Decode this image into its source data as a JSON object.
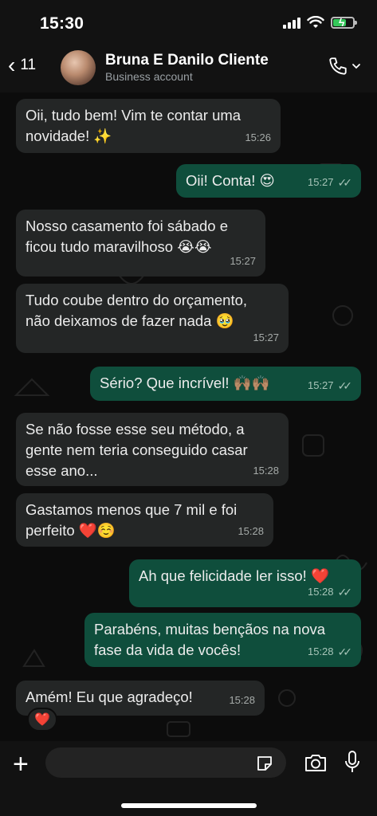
{
  "status_bar": {
    "time": "15:30"
  },
  "header": {
    "back_count": "11",
    "contact_name": "Bruna E Danilo Cliente",
    "contact_subtitle": "Business account"
  },
  "messages": [
    {
      "dir": "in",
      "text": "Oii, tudo bem! Vim te contar uma\nnovidade! ✨",
      "time": "15:26"
    },
    {
      "dir": "out",
      "text": "Oii! Conta! 😍",
      "time": "15:27"
    },
    {
      "dir": "in",
      "text": "Nosso casamento foi sábado e\nficou tudo maravilhoso 😭😭",
      "time": "15:27"
    },
    {
      "dir": "in",
      "text": "Tudo coube dentro do orçamento,\nnão deixamos de fazer nada 🥹",
      "time": "15:27"
    },
    {
      "dir": "out",
      "text": "Sério? Que incrível! 🙌🏽🙌🏽",
      "time": "15:27"
    },
    {
      "dir": "in",
      "text": "Se não fosse esse seu método, a\ngente nem teria conseguido casar\nesse ano...",
      "time": "15:28"
    },
    {
      "dir": "in",
      "text": "Gastamos menos que 7 mil e foi\nperfeito ❤️☺️",
      "time": "15:28"
    },
    {
      "dir": "out",
      "text": "Ah que felicidade ler isso! ❤️",
      "time": "15:28"
    },
    {
      "dir": "out",
      "text": "Parabéns, muitas bençãos na nova\nfase da vida de vocês!",
      "time": "15:28"
    },
    {
      "dir": "in",
      "text": "Amém! Eu que agradeço!",
      "time": "15:28",
      "reaction": "❤️"
    }
  ],
  "composer": {
    "placeholder": ""
  },
  "icons": [
    "back-chevron-icon",
    "phone-icon",
    "chevron-down-icon",
    "plus-icon",
    "sticker-icon",
    "camera-icon",
    "mic-icon"
  ],
  "colors": {
    "incoming": "#242626",
    "outgoing": "#0f4e3c",
    "background": "#0c0c0c"
  }
}
